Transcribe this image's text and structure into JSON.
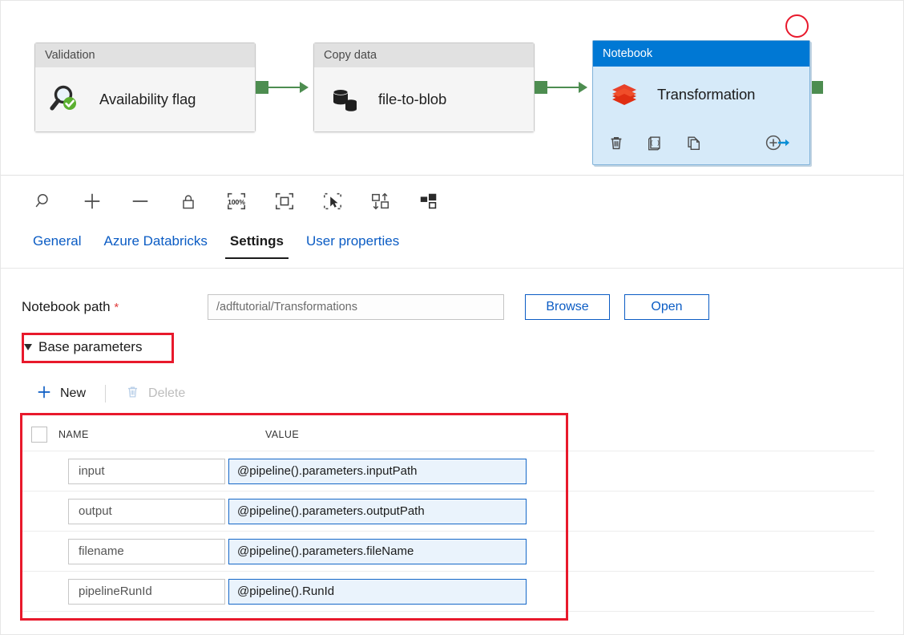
{
  "canvas": {
    "nodes": [
      {
        "type_label": "Validation",
        "name": "Availability flag",
        "icon": "magnifier-check-icon",
        "selected": false
      },
      {
        "type_label": "Copy data",
        "name": "file-to-blob",
        "icon": "database-copy-icon",
        "selected": false
      },
      {
        "type_label": "Notebook",
        "name": "Transformation",
        "icon": "databricks-layers-icon",
        "selected": true,
        "actions": [
          {
            "name": "delete-activity",
            "icon": "trash-icon"
          },
          {
            "name": "view-code",
            "icon": "code-braces-icon"
          },
          {
            "name": "duplicate-activity",
            "icon": "copy-pages-icon"
          },
          {
            "name": "add-output",
            "icon": "add-output-arrow-icon"
          }
        ]
      }
    ],
    "annotation_circle_color": "#e8192c",
    "connector_color": "#4d8d50",
    "selected_header_color": "#0078d4",
    "selected_body_color": "#d6eaf9"
  },
  "canvas_toolbar": {
    "buttons": [
      {
        "name": "zoom-search-icon",
        "label": "Zoom"
      },
      {
        "name": "zoom-in-icon",
        "label": "Zoom in"
      },
      {
        "name": "zoom-out-icon",
        "label": "Zoom out"
      },
      {
        "name": "lock-icon",
        "label": "Lock canvas"
      },
      {
        "name": "zoom-100-percent-icon",
        "label": "100%"
      },
      {
        "name": "zoom-to-fit-icon",
        "label": "Zoom to fit"
      },
      {
        "name": "select-pointer-icon",
        "label": "Select"
      },
      {
        "name": "auto-align-icon",
        "label": "Auto align"
      },
      {
        "name": "auto-layout-icon",
        "label": "Auto layout"
      }
    ],
    "zoom_level_label": "100%"
  },
  "tabs": [
    {
      "label": "General",
      "active": false
    },
    {
      "label": "Azure Databricks",
      "active": false
    },
    {
      "label": "Settings",
      "active": true
    },
    {
      "label": "User properties",
      "active": false
    }
  ],
  "settings": {
    "notebook_path": {
      "label": "Notebook path",
      "required_marker": "*",
      "value": "/adftutorial/Transformations",
      "placeholder": "/adftutorial/Transformations"
    },
    "browse_button": "Browse",
    "open_button": "Open",
    "base_parameters": {
      "section_title": "Base parameters",
      "expanded": true,
      "new_button": "New",
      "delete_button": "Delete",
      "delete_disabled": true,
      "columns": [
        "NAME",
        "VALUE"
      ],
      "rows": [
        {
          "name": "input",
          "value": "@pipeline().parameters.inputPath"
        },
        {
          "name": "output",
          "value": "@pipeline().parameters.outputPath"
        },
        {
          "name": "filename",
          "value": "@pipeline().parameters.fileName"
        },
        {
          "name": "pipelineRunId",
          "value": "@pipeline().RunId"
        }
      ]
    }
  },
  "colors": {
    "accent_blue": "#0b5cc4",
    "selected_blue": "#0078d4",
    "annotation_red": "#e8192c",
    "required_red": "#e03b3b",
    "connector_green": "#4d8d50",
    "databricks_red": "#e8412a",
    "value_field_border": "#1668c8",
    "value_field_bg": "#eaf3fc"
  }
}
